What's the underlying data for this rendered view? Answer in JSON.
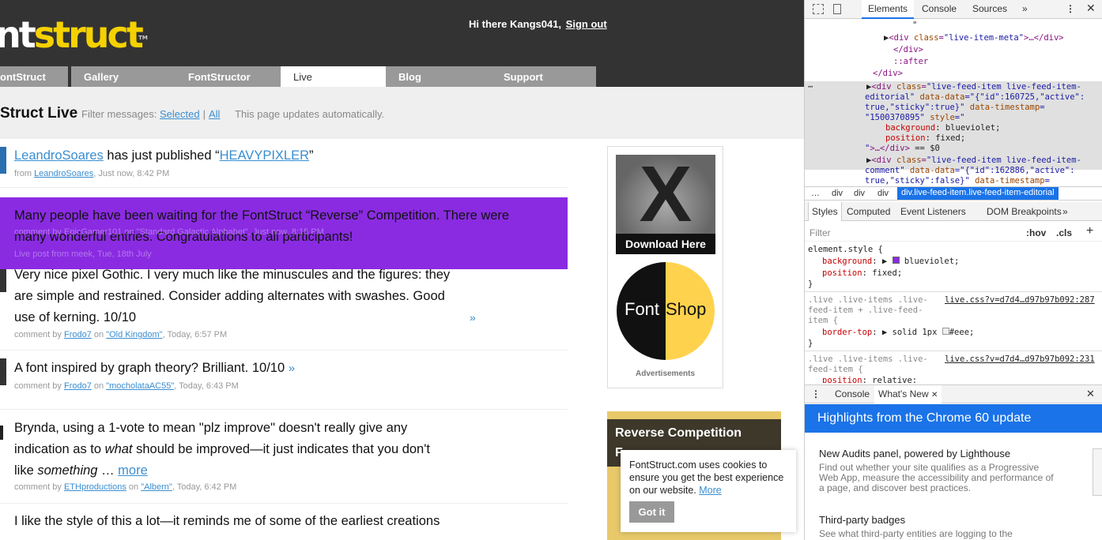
{
  "site": {
    "logo": {
      "part1": "nt",
      "part2": "struct",
      "tm": "TM"
    },
    "greeting": "Hi there Kangs041,",
    "sign_out": "Sign out",
    "nav": [
      "ontStruct",
      "Gallery",
      "FontStructor",
      "Live",
      "Blog",
      "Support"
    ],
    "live_title": "Struct Live",
    "filter_label": "Filter messages:",
    "filter_selected": "Selected",
    "filter_sep": "|",
    "filter_all": "All",
    "filter_note": "This page updates automatically."
  },
  "feed": [
    {
      "pre": "",
      "user": "LeandroSoares",
      "mid": " has just published “",
      "link": "HEAVYPIXLER",
      "post": "”",
      "meta_pre": "from ",
      "meta_user": "LeandroSoares",
      "meta_time": ", Just now, 8:42 PM"
    },
    {
      "line1": "Very nice pixel Gothic. I very much like the minuscules and the figures: they",
      "line2": "are simple and restrained. Consider adding alternates with swashes. Good",
      "line3": "use of kerning. 10/10",
      "more": "»",
      "meta_pre": "comment by ",
      "meta_user": "Frodo7",
      "meta_on": " on ",
      "meta_font": "\"Old Kingdom\"",
      "meta_time": ", Today, 6:57 PM"
    },
    {
      "text": "A font inspired by graph theory? Brilliant. 10/10",
      "more": "»",
      "meta_pre": "comment by ",
      "meta_user": "Frodo7",
      "meta_on": " on ",
      "meta_font": "\"mocholataAC55\"",
      "meta_time": ", Today, 6:43 PM"
    },
    {
      "line1": "Brynda, using a 1-vote to mean \"plz improve\" doesn't really give any",
      "line2": "indication as to ",
      "line2_em": "what",
      "line2_post": " should be improved—it just indicates that you don't",
      "line3_pre": "like ",
      "line3_em": "something",
      "line3_post": " … ",
      "more": "more",
      "meta_pre": "comment by ",
      "meta_user": "ETHproductions",
      "meta_on": " on ",
      "meta_font": "\"Albern\"",
      "meta_time": ", Today, 6:42 PM"
    },
    {
      "line1": "I like the style of this a lot—it reminds me of some of the earliest creations"
    }
  ],
  "editorial": {
    "line1": "Many people have been waiting for the FontStruct “Reverse” Competition. There were",
    "line2": "many wonderful entries. Congratulations to all participants!",
    "ghost1": "comment by EpicGamer101 on \"Standard Galactic Alphabet\", Just now, 8:15 PM",
    "ghost2": "Live post from meek, Tue, 18th July",
    "color": "#8a2be2"
  },
  "ads": {
    "download": "Download Here",
    "fontshop_left": "Font",
    "fontshop_right": "Shop",
    "label": "Advertisements"
  },
  "reverse": {
    "title": "Reverse Competition",
    "sub": "F"
  },
  "cookie": {
    "text": "FontStruct.com uses cookies to ensure you get the best experience on our website.",
    "more": "More",
    "button": "Got it"
  },
  "devtools": {
    "tabs": [
      "Elements",
      "Console",
      "Sources",
      "»"
    ],
    "crumbs": [
      "…",
      "div",
      "div",
      "div"
    ],
    "crumb_selected": "div.live-feed-item.live-feed-item-editorial",
    "style_tabs": [
      "Styles",
      "Computed",
      "Event Listeners",
      "DOM Breakpoints",
      "»"
    ],
    "filter": "Filter",
    "hov": ":hov",
    "cls": ".cls",
    "plus": "+",
    "drawer_tabs": [
      "Console",
      "What's New"
    ],
    "highlight": "Highlights from the Chrome 60 update",
    "news": [
      {
        "title": "New Audits panel, powered by Lighthouse",
        "desc": "Find out whether your site qualifies as a Progressive Web App, measure the accessibility and performance of a page, and discover best practices."
      },
      {
        "title": "Third-party badges",
        "desc": "See what third-party entities are logging to the"
      }
    ]
  }
}
